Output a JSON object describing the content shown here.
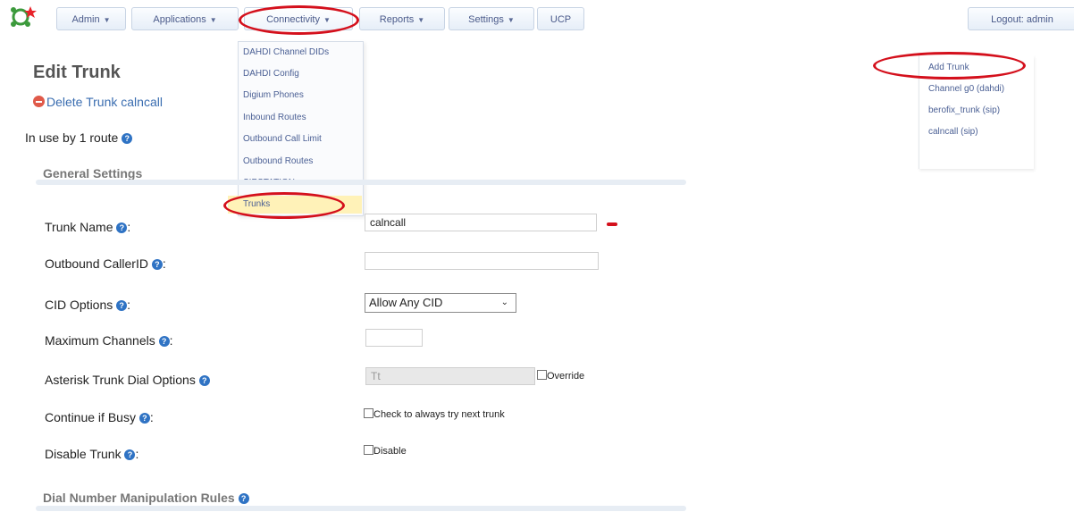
{
  "nav": {
    "items": [
      {
        "label": "Admin"
      },
      {
        "label": "Applications"
      },
      {
        "label": "Connectivity"
      },
      {
        "label": "Reports"
      },
      {
        "label": "Settings"
      },
      {
        "label": "UCP"
      }
    ],
    "logout": "Logout: admin"
  },
  "connectivity_menu": {
    "items": [
      "DAHDI Channel DIDs",
      "DAHDI Config",
      "Digium Phones",
      "Inbound Routes",
      "Outbound Call Limit",
      "Outbound Routes",
      "SIPSTATION",
      "Trunks"
    ]
  },
  "trunk_list": {
    "items": [
      "Add Trunk",
      "Channel g0 (dahdi)",
      "berofix_trunk (sip)",
      "calncall (sip)"
    ]
  },
  "page": {
    "title": "Edit Trunk",
    "delete_link": "Delete Trunk calncall",
    "in_use": "In use by 1 route",
    "general_settings": "General Settings",
    "dial_rules": "Dial Number Manipulation Rules"
  },
  "form": {
    "trunk_name_label": "Trunk Name",
    "trunk_name_value": "calncall",
    "outbound_callerid_label": "Outbound CallerID",
    "outbound_callerid_value": "",
    "cid_options_label": "CID Options",
    "cid_options_value": "Allow Any CID",
    "max_channels_label": "Maximum Channels",
    "max_channels_value": "",
    "dial_options_label": "Asterisk Trunk Dial Options",
    "dial_options_value": "Tt",
    "override_label": "Override",
    "continue_busy_label": "Continue if Busy",
    "continue_busy_check": "Check to always try next trunk",
    "disable_trunk_label": "Disable Trunk",
    "disable_check": "Disable",
    "label_suffix": ":"
  },
  "colors": {
    "highlight_ring": "#d4101c",
    "link": "#3a6db0",
    "help_icon": "#2f73c4"
  }
}
